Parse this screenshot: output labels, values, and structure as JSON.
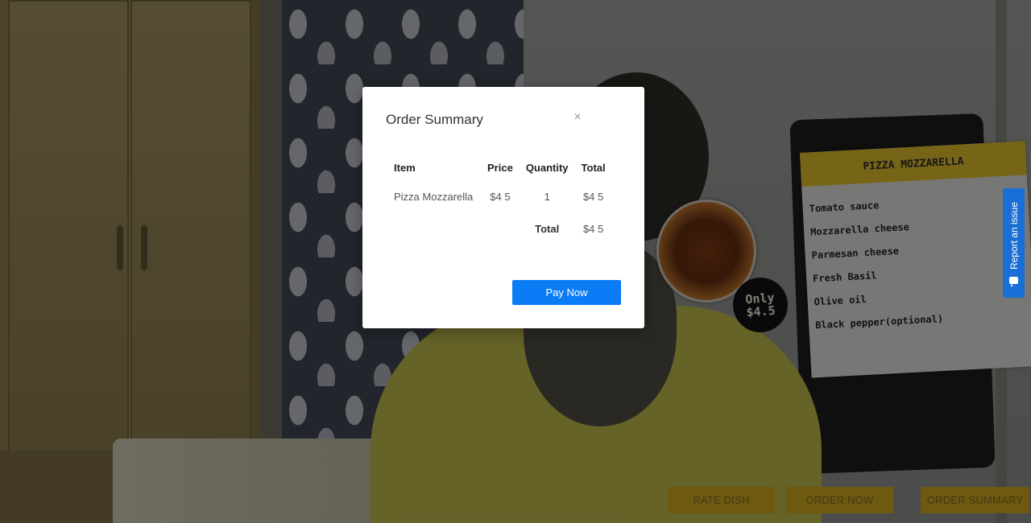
{
  "modal": {
    "title": "Order Summary",
    "close_icon": "close-icon",
    "table": {
      "headers": [
        "Item",
        "Price",
        "Quantity",
        "Total"
      ],
      "rows": [
        {
          "item": "Pizza Mozzarella",
          "price": "$4 5",
          "quantity": "1",
          "total": "$4 5"
        }
      ],
      "footer": {
        "label": "Total",
        "value": "$4 5"
      }
    },
    "pay_button": "Pay Now"
  },
  "ar_menu_card": {
    "title": "PIZZA MOZZARELLA",
    "ingredients": [
      "Tomato sauce",
      "Mozzarella cheese",
      "Parmesan cheese",
      "Fresh Basil",
      "Olive oil",
      "Black pepper(optional)"
    ]
  },
  "price_bubble": {
    "line1": "Only",
    "line2": "$4.5"
  },
  "feedback": {
    "label": "Report an issue",
    "icon": "message-icon"
  },
  "bottom_bar": {
    "rate_dish": "RATE DISH",
    "order_now": "ORDER NOW",
    "order_summary": "ORDER SUMMARY"
  },
  "colors": {
    "accent_yellow": "#c9a21e",
    "pay_blue": "#0a7cf5",
    "feedback_blue": "#1a6fd6"
  }
}
